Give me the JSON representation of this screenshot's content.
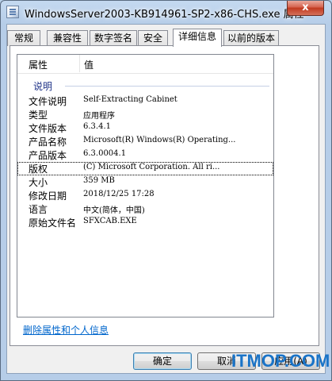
{
  "window": {
    "title": "WindowsServer2003-KB914961-SP2-x86-CHS.exe 属性",
    "close_glyph": "x"
  },
  "tabs": [
    {
      "label": "常规"
    },
    {
      "label": "兼容性"
    },
    {
      "label": "数字签名"
    },
    {
      "label": "安全"
    },
    {
      "label": "详细信息",
      "active": true
    },
    {
      "label": "以前的版本"
    }
  ],
  "details": {
    "columns": {
      "property": "属性",
      "value": "值"
    },
    "group": "说明",
    "rows": [
      {
        "key": "文件说明",
        "value": "Self-Extracting Cabinet"
      },
      {
        "key": "类型",
        "value": "应用程序"
      },
      {
        "key": "文件版本",
        "value": "6.3.4.1"
      },
      {
        "key": "产品名称",
        "value": "Microsoft(R) Windows(R) Operating..."
      },
      {
        "key": "产品版本",
        "value": "6.3.0004.1"
      },
      {
        "key": "版权",
        "value": "(C) Microsoft Corporation. All ri...",
        "selected": true
      },
      {
        "key": "大小",
        "value": "359 MB"
      },
      {
        "key": "修改日期",
        "value": "2018/12/25 17:28"
      },
      {
        "key": "语言",
        "value": "中文(简体，中国)"
      },
      {
        "key": "原始文件名",
        "value": "SFXCAB.EXE"
      }
    ]
  },
  "remove_link": "删除属性和个人信息",
  "buttons": {
    "ok": "确定",
    "cancel": "取消",
    "apply": "应用(A)"
  },
  "watermark": {
    "text": "ITMOP.COM"
  }
}
